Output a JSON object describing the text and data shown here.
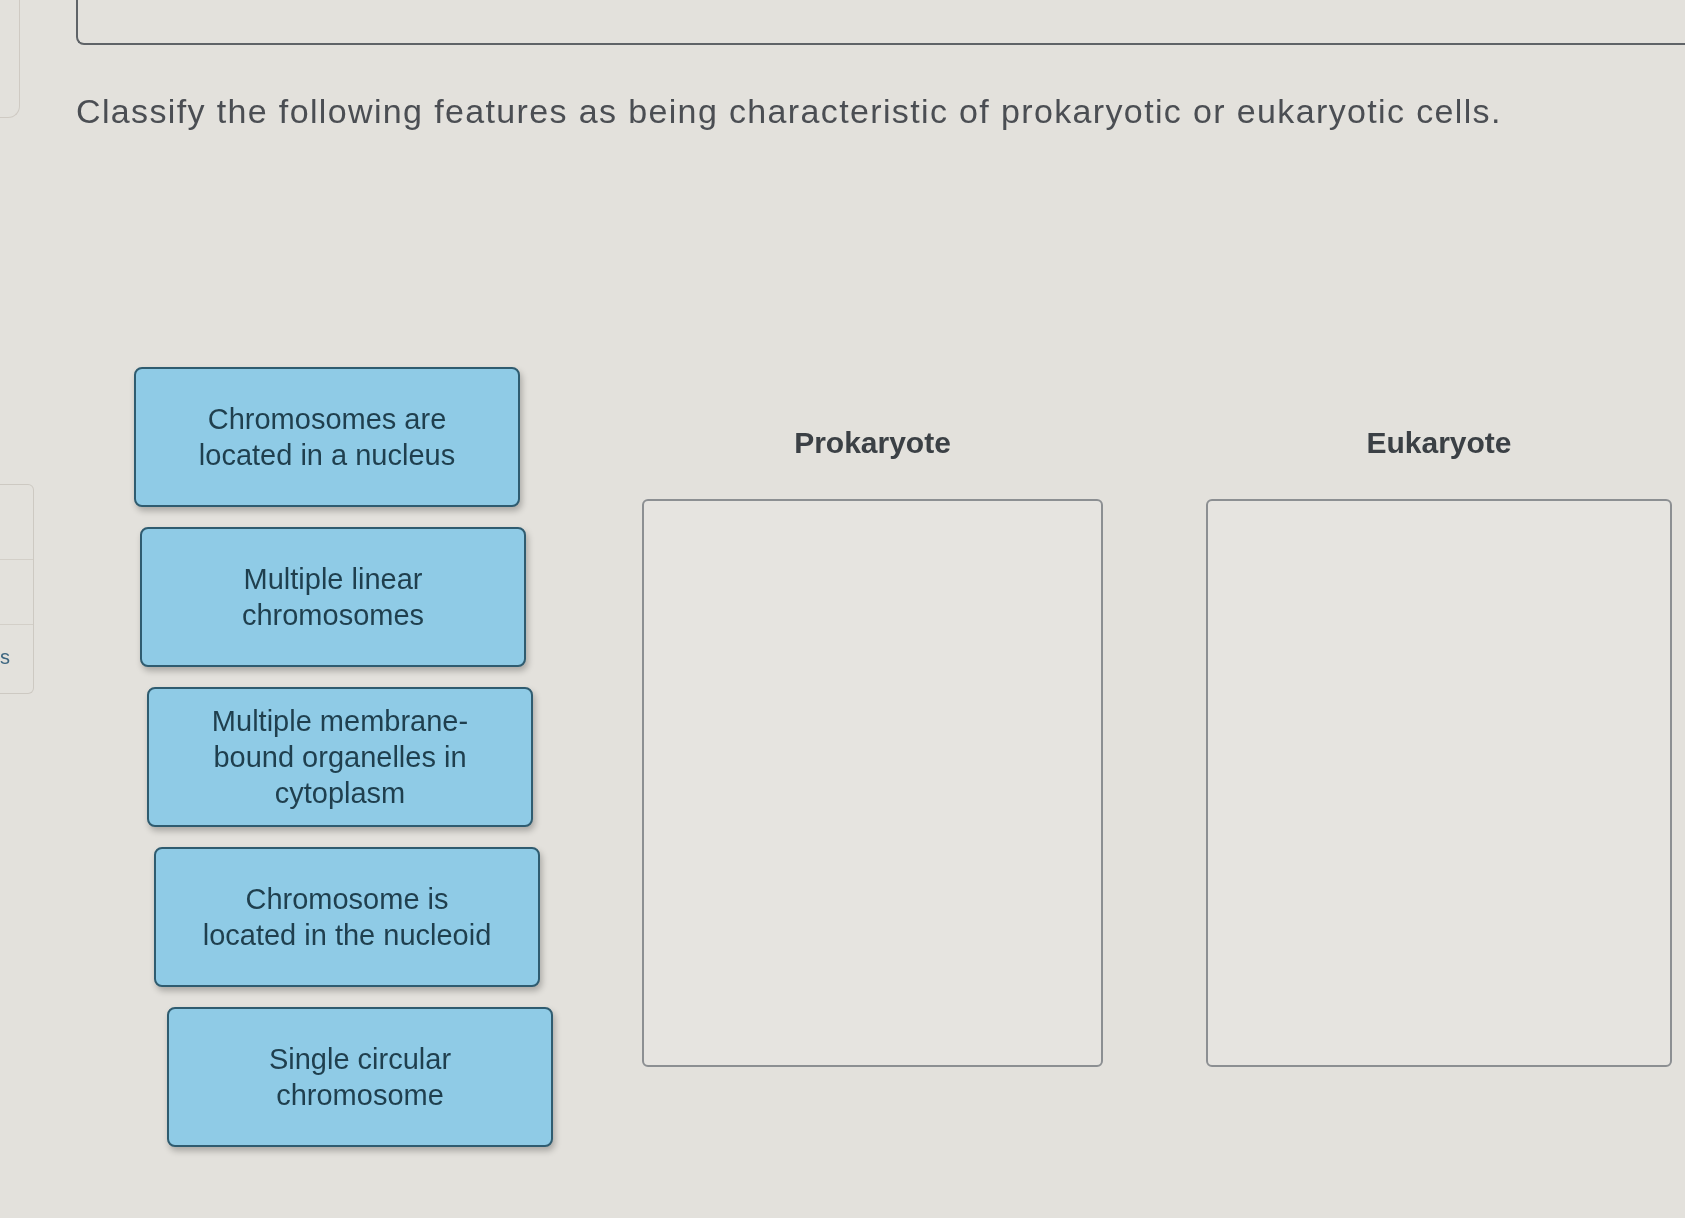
{
  "side_fragment": {
    "text": "s"
  },
  "question": "Classify the following features as being characteristic of prokaryotic or eukaryotic cells.",
  "cards": [
    {
      "text": "Chromosomes are located in a nucleus"
    },
    {
      "text": "Multiple linear chromosomes"
    },
    {
      "text": "Multiple membrane-bound organelles in cytoplasm"
    },
    {
      "text": "Chromosome is located in the nucleoid"
    },
    {
      "text": "Single circular chromosome"
    }
  ],
  "zones": [
    {
      "label": "Prokaryote"
    },
    {
      "label": "Eukaryote"
    }
  ]
}
